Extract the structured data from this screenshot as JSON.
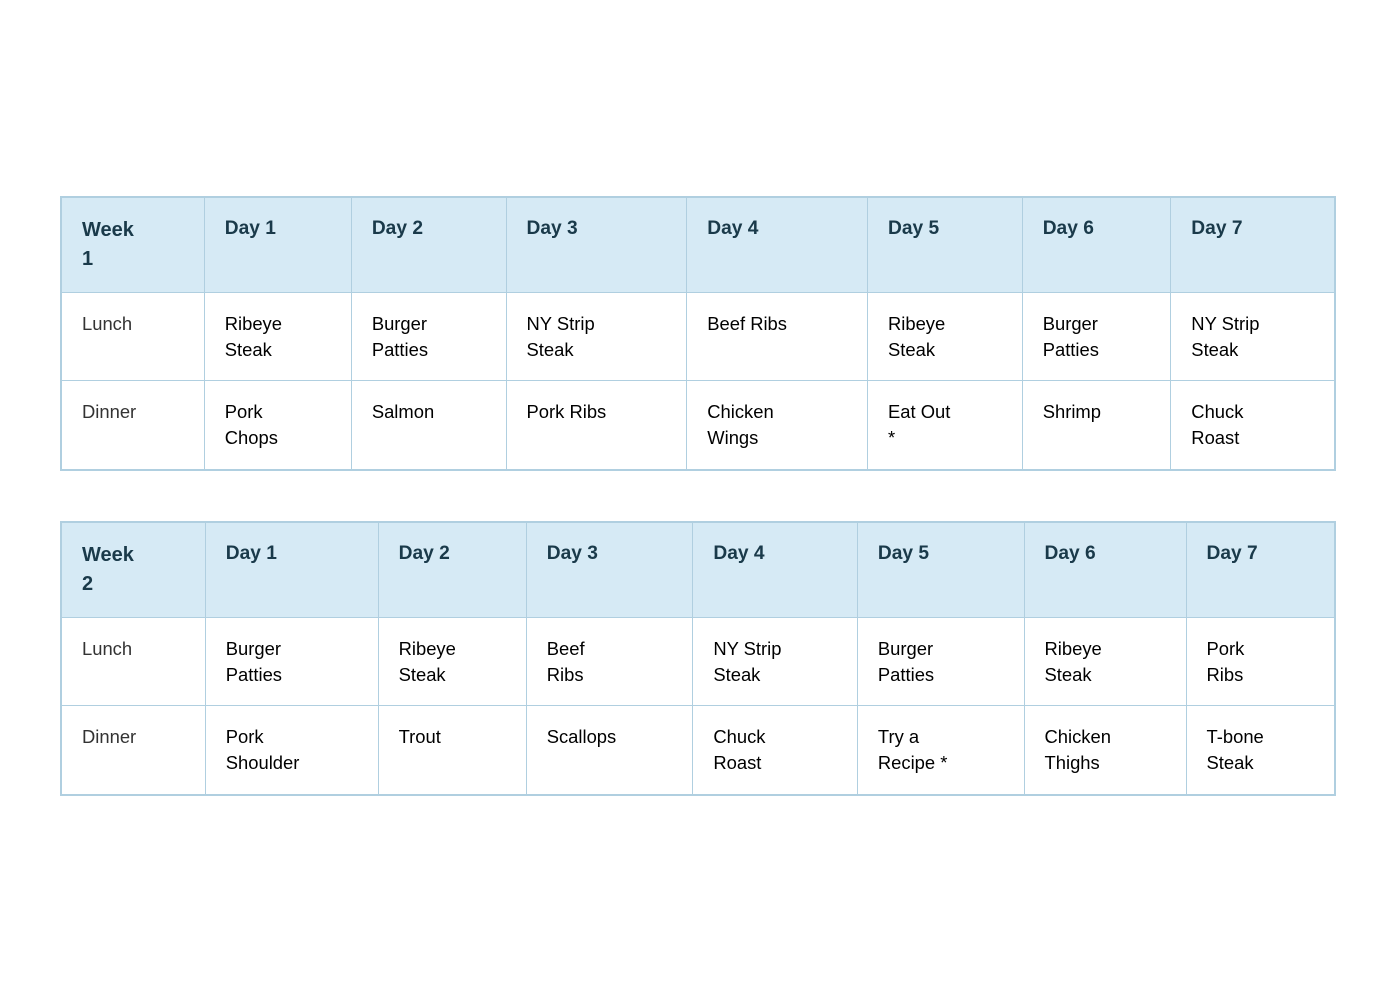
{
  "week1": {
    "header": {
      "week": "Week\n1",
      "days": [
        "Day 1",
        "Day 2",
        "Day 3",
        "Day 4",
        "Day 5",
        "Day 6",
        "Day 7"
      ]
    },
    "rows": [
      {
        "label": "Lunch",
        "cells": [
          "Ribeye\nSteak",
          "Burger\nPatties",
          "NY Strip\nSteak",
          "Beef Ribs",
          "Ribeye\nSteak",
          "Burger\nPatties",
          "NY Strip\nSteak"
        ]
      },
      {
        "label": "Dinner",
        "cells": [
          "Pork\nChops",
          "Salmon",
          "Pork Ribs",
          "Chicken\nWings",
          "Eat Out\n*",
          "Shrimp",
          "Chuck\nRoast"
        ]
      }
    ]
  },
  "week2": {
    "header": {
      "week": "Week\n2",
      "days": [
        "Day 1",
        "Day 2",
        "Day 3",
        "Day 4",
        "Day 5",
        "Day 6",
        "Day 7"
      ]
    },
    "rows": [
      {
        "label": "Lunch",
        "cells": [
          "Burger\nPatties",
          "Ribeye\nSteak",
          "Beef\nRibs",
          "NY Strip\nSteak",
          "Burger\nPatties",
          "Ribeye\nSteak",
          "Pork\nRibs"
        ]
      },
      {
        "label": "Dinner",
        "cells": [
          "Pork\nShoulder",
          "Trout",
          "Scallops",
          "Chuck\nRoast",
          "Try a\nRecipe *",
          "Chicken\nThighs",
          "T-bone\nSteak"
        ]
      }
    ]
  }
}
